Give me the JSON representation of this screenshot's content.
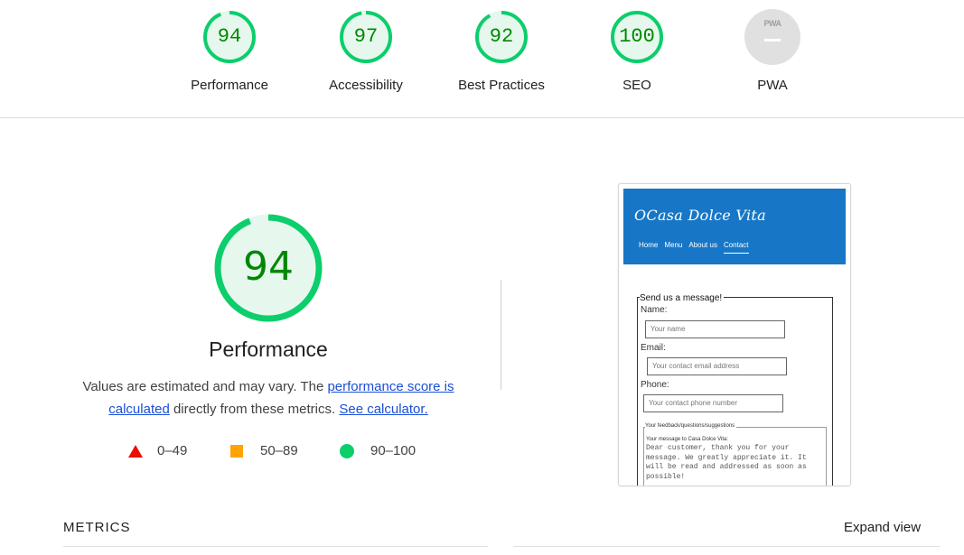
{
  "categories": [
    {
      "label": "Performance",
      "score": "94",
      "value": 94
    },
    {
      "label": "Accessibility",
      "score": "97",
      "value": 97
    },
    {
      "label": "Best Practices",
      "score": "92",
      "value": 92
    },
    {
      "label": "SEO",
      "score": "100",
      "value": 100
    },
    {
      "label": "PWA",
      "badge": "PWA"
    }
  ],
  "main": {
    "score": "94",
    "value": 94,
    "title": "Performance",
    "desc_prefix": "Values are estimated and may vary. The ",
    "desc_link1": "performance score is calculated",
    "desc_middle": " directly from these metrics. ",
    "desc_link2": "See calculator."
  },
  "legend": [
    {
      "range": "0–49",
      "shape": "triangle",
      "color": "#eb0f00"
    },
    {
      "range": "50–89",
      "shape": "square",
      "color": "#ffa400"
    },
    {
      "range": "90–100",
      "shape": "circle",
      "color": "#0cce6b"
    }
  ],
  "preview": {
    "logo": "OCasa Dolce Vita",
    "nav": [
      "Home",
      "Menu",
      "About us",
      "Contact"
    ],
    "form_legend": "Send us a message!",
    "name_label": "Name:",
    "name_placeholder": "Your name",
    "email_label": "Email:",
    "email_placeholder": "Your contact email address",
    "phone_label": "Phone:",
    "phone_placeholder": "Your contact phone number",
    "feedback_legend": "Your feedback/questions/suggestions",
    "message_label": "Your message to Casa Dolce Vita:",
    "message_text": "Dear customer, thank you for your message. We greatly appreciate it. It will be read and addressed as soon as possible!"
  },
  "metrics": {
    "label": "METRICS",
    "expand": "Expand view"
  },
  "colors": {
    "pass": "#0cce6b",
    "pass_fill": "#e6f8ee",
    "pass_text": "#008800",
    "header_blue": "#1777c6",
    "link": "#1a4fd6"
  }
}
